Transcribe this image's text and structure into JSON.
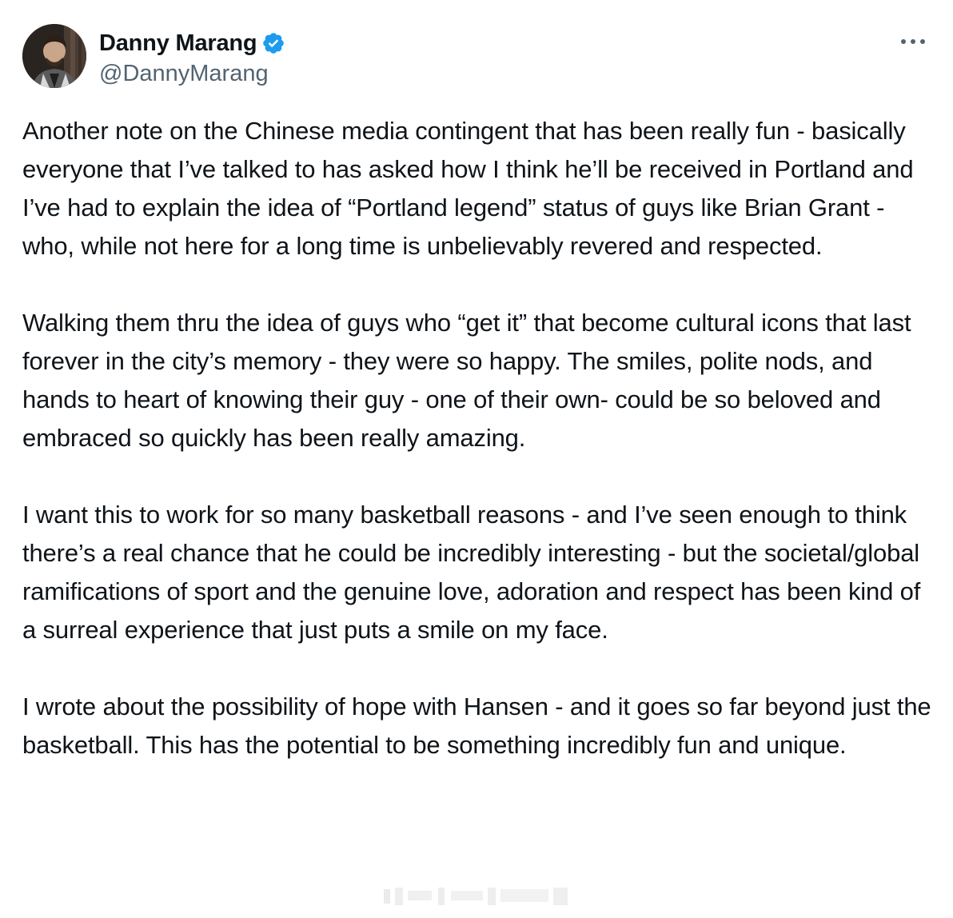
{
  "author": {
    "display_name": "Danny Marang",
    "handle": "@DannyMarang",
    "verified": true,
    "verified_color": "#1d9bf0",
    "avatar": "profile-photo"
  },
  "menu": {
    "icon": "more-horizontal-icon"
  },
  "post": {
    "paragraphs": [
      "Another note on the Chinese media contingent that has been really fun - basically everyone that I’ve talked to has asked how I think he’ll be received in Portland and I’ve had to explain the idea of “Portland legend” status of guys like Brian Grant - who, while not here for a long time is unbelievably revered and respected.",
      "Walking them thru the idea of guys who “get it” that become cultural icons that last forever in the city’s memory - they were so happy. The smiles, polite nods, and hands to heart of knowing their guy - one of their own- could be so beloved and embraced so quickly has been really amazing.",
      "I want this to work for so many basketball reasons - and I’ve seen enough to think there’s a real chance that he could be incredibly interesting - but the societal/global ramifications of sport and the genuine love, adoration and respect has been kind of a surreal experience that just puts a smile on my face.",
      "I wrote about the possibility of hope with Hansen - and it goes so far beyond just the basketball. This has the potential to be something incredibly fun and unique."
    ]
  },
  "colors": {
    "text": "#0f1419",
    "secondary": "#536471",
    "background": "#ffffff"
  }
}
